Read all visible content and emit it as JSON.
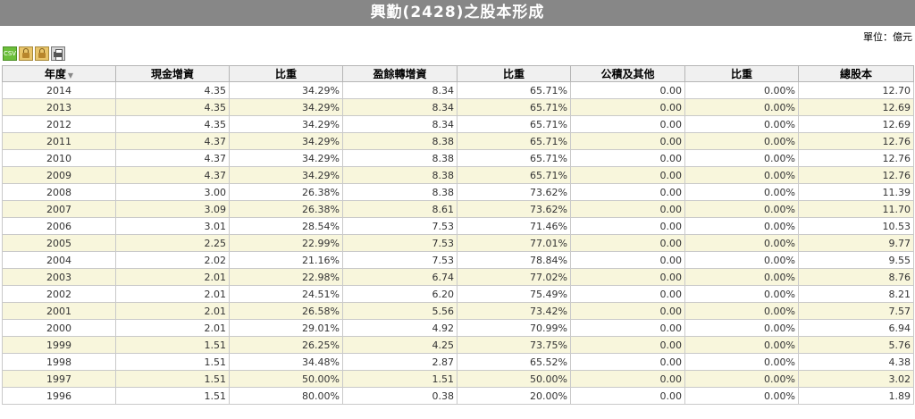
{
  "title": "興勤(2428)之股本形成",
  "unit": "單位：億元",
  "toolbar": {
    "csv_label": "CSV",
    "icons": [
      "csv-icon",
      "lock-icon",
      "lock-icon",
      "print-icon"
    ]
  },
  "table": {
    "headers": [
      "年度",
      "現金增資",
      "比重",
      "盈餘轉增資",
      "比重",
      "公積及其他",
      "比重",
      "總股本"
    ],
    "sort_indicator": "▼",
    "rows": [
      [
        "2014",
        "4.35",
        "34.29%",
        "8.34",
        "65.71%",
        "0.00",
        "0.00%",
        "12.70"
      ],
      [
        "2013",
        "4.35",
        "34.29%",
        "8.34",
        "65.71%",
        "0.00",
        "0.00%",
        "12.69"
      ],
      [
        "2012",
        "4.35",
        "34.29%",
        "8.34",
        "65.71%",
        "0.00",
        "0.00%",
        "12.69"
      ],
      [
        "2011",
        "4.37",
        "34.29%",
        "8.38",
        "65.71%",
        "0.00",
        "0.00%",
        "12.76"
      ],
      [
        "2010",
        "4.37",
        "34.29%",
        "8.38",
        "65.71%",
        "0.00",
        "0.00%",
        "12.76"
      ],
      [
        "2009",
        "4.37",
        "34.29%",
        "8.38",
        "65.71%",
        "0.00",
        "0.00%",
        "12.76"
      ],
      [
        "2008",
        "3.00",
        "26.38%",
        "8.38",
        "73.62%",
        "0.00",
        "0.00%",
        "11.39"
      ],
      [
        "2007",
        "3.09",
        "26.38%",
        "8.61",
        "73.62%",
        "0.00",
        "0.00%",
        "11.70"
      ],
      [
        "2006",
        "3.01",
        "28.54%",
        "7.53",
        "71.46%",
        "0.00",
        "0.00%",
        "10.53"
      ],
      [
        "2005",
        "2.25",
        "22.99%",
        "7.53",
        "77.01%",
        "0.00",
        "0.00%",
        "9.77"
      ],
      [
        "2004",
        "2.02",
        "21.16%",
        "7.53",
        "78.84%",
        "0.00",
        "0.00%",
        "9.55"
      ],
      [
        "2003",
        "2.01",
        "22.98%",
        "6.74",
        "77.02%",
        "0.00",
        "0.00%",
        "8.76"
      ],
      [
        "2002",
        "2.01",
        "24.51%",
        "6.20",
        "75.49%",
        "0.00",
        "0.00%",
        "8.21"
      ],
      [
        "2001",
        "2.01",
        "26.58%",
        "5.56",
        "73.42%",
        "0.00",
        "0.00%",
        "7.57"
      ],
      [
        "2000",
        "2.01",
        "29.01%",
        "4.92",
        "70.99%",
        "0.00",
        "0.00%",
        "6.94"
      ],
      [
        "1999",
        "1.51",
        "26.25%",
        "4.25",
        "73.75%",
        "0.00",
        "0.00%",
        "5.76"
      ],
      [
        "1998",
        "1.51",
        "34.48%",
        "2.87",
        "65.52%",
        "0.00",
        "0.00%",
        "4.38"
      ],
      [
        "1997",
        "1.51",
        "50.00%",
        "1.51",
        "50.00%",
        "0.00",
        "0.00%",
        "3.02"
      ],
      [
        "1996",
        "1.51",
        "80.00%",
        "0.38",
        "20.00%",
        "0.00",
        "0.00%",
        "1.89"
      ]
    ]
  },
  "colors": {
    "title_bg": "#878787",
    "alt_row": "#f8f6dc",
    "header_bg": "#f0f0f0"
  }
}
